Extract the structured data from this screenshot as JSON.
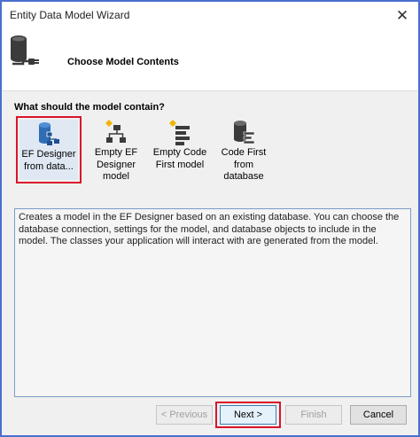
{
  "window": {
    "title": "Entity Data Model Wizard"
  },
  "header": {
    "title": "Choose Model Contents"
  },
  "question": "What should the model contain?",
  "options": [
    {
      "icon": "ef-designer-database-icon",
      "label_lines": [
        "EF Designer",
        "from data..."
      ],
      "selected": true
    },
    {
      "icon": "empty-ef-designer-icon",
      "label_lines": [
        "Empty EF",
        "Designer",
        "model"
      ],
      "selected": false
    },
    {
      "icon": "empty-code-first-icon",
      "label_lines": [
        "Empty Code",
        "First model"
      ],
      "selected": false
    },
    {
      "icon": "code-first-database-icon",
      "label_lines": [
        "Code First",
        "from",
        "database"
      ],
      "selected": false
    }
  ],
  "description": "Creates a model in the EF Designer based on an existing database. You can choose the database connection, settings for the model, and database objects to include in the model. The classes your application will interact with are generated from the model.",
  "buttons": {
    "previous": "< Previous",
    "next": "Next >",
    "finish": "Finish",
    "cancel": "Cancel"
  },
  "colors": {
    "highlight": "#d9142a",
    "window_border": "#4a6fd0",
    "accent": "#3c7fb1"
  }
}
